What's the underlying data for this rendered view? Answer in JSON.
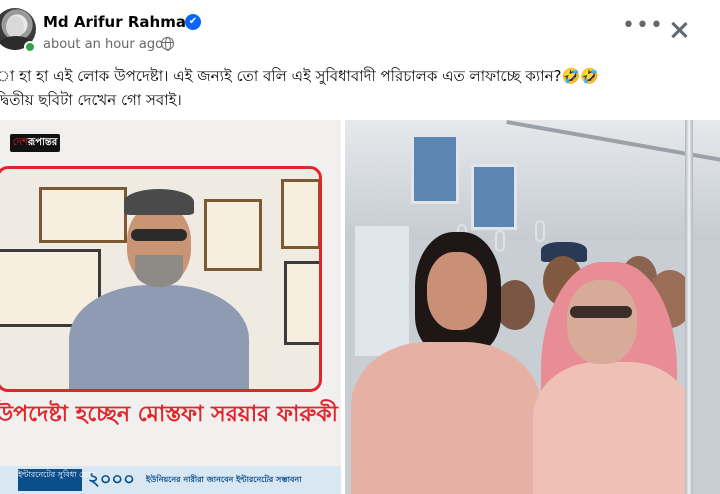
{
  "post": {
    "author": "Md Arifur Rahman",
    "verified_mark": "✔",
    "timestamp": "about an hour ago",
    "more_label": "•••",
    "text_line1": "া হা হা এই লোক উপদেষ্টা। এই জন্যই তো বলি এই সুবিধাবাদী পরিচালক এত লাফাচ্ছে ক্যান?🤣🤣",
    "text_line2": "দ্বিতীয় ছবিটা দেখেন গো সবাই।"
  },
  "left_image": {
    "brand_prefix": "দেশ",
    "brand_suffix": "রূপান্তর",
    "headline": "উপদেষ্টা হচ্ছেন মোস্তফা সরয়ার ফারুকী",
    "ticker_tag": "ইন্টারনেটের সুবিধা ভোগ",
    "ticker_number": "২০০০",
    "ticker_text": "ইউনিয়নের নারীরা জানবেন ইন্টারনেটের সম্ভাবনা"
  },
  "icons": {
    "globe": "globe-icon",
    "more": "more-options-icon",
    "close": "close-icon",
    "verified": "verified-badge-icon"
  },
  "colors": {
    "verified_blue": "#0866ff",
    "online_green": "#31a24c",
    "headline_red": "#e0262b",
    "ticker_blue": "#0b4e8c"
  }
}
